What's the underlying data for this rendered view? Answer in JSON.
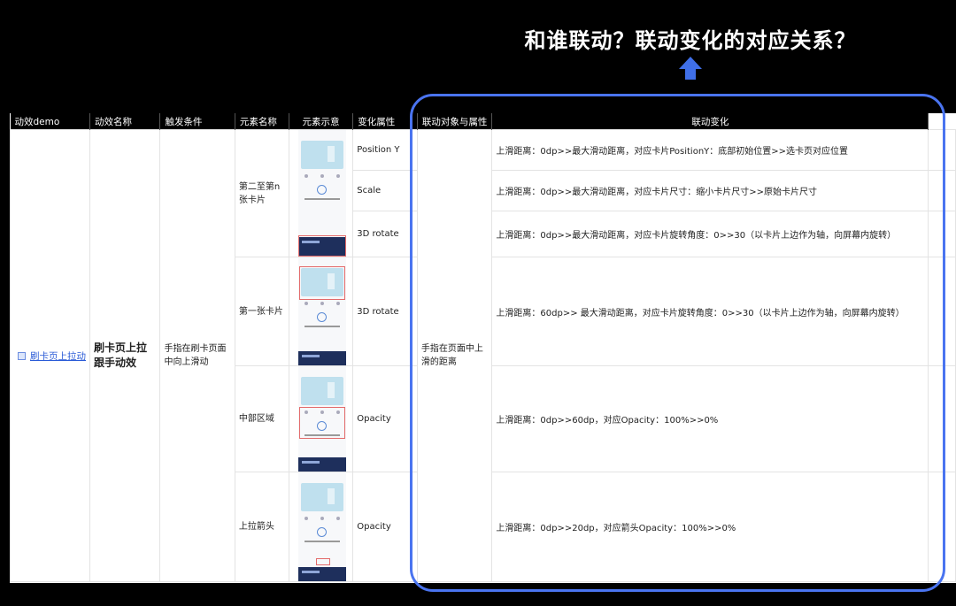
{
  "headline": "和谁联动？联动变化的对应关系？",
  "colors": {
    "background": "#000000",
    "frame": "#4a74f0",
    "arrow": "#3f6fe8",
    "link": "#2a5bd7"
  },
  "icons": {
    "arrow": "up-arrow-icon",
    "link": "link-icon"
  },
  "table": {
    "headers": [
      "动效demo",
      "动效名称",
      "触发条件",
      "元素名称",
      "元素示意",
      "变化属性",
      "联动对象与属性",
      "联动变化"
    ],
    "demo_link": "刷卡页上拉动",
    "effect_name": "刷卡页上拉跟手动效",
    "trigger": "手指在刷卡页面中向上滑动",
    "linked_object": "手指在页面中上滑的距离",
    "groups": [
      {
        "element": "第二至第n张卡片"
      },
      {
        "element": "第一张卡片"
      },
      {
        "element": "中部区域"
      },
      {
        "element": "上拉箭头"
      }
    ],
    "rows": [
      {
        "property": "Position Y",
        "change": "上滑距离：0dp>>最大滑动距离，对应卡片PositionY：底部初始位置>>选卡页对应位置"
      },
      {
        "property": "Scale",
        "change": "上滑距离：0dp>>最大滑动距离，对应卡片尺寸：缩小卡片尺寸>>原始卡片尺寸"
      },
      {
        "property": "3D rotate",
        "change": "上滑距离：0dp>>最大滑动距离，对应卡片旋转角度：0>>30（以卡片上边作为轴，向屏幕内旋转）"
      },
      {
        "property": "3D rotate",
        "change": "上滑距离：60dp>> 最大滑动距离，对应卡片旋转角度：0>>30（以卡片上边作为轴，向屏幕内旋转）"
      },
      {
        "property": "Opacity",
        "change": "上滑距离：0dp>>60dp，对应Opacity：100%>>0%"
      },
      {
        "property": "Opacity",
        "change": "上滑距离：0dp>>20dp，对应箭头Opacity：100%>>0%"
      }
    ]
  }
}
